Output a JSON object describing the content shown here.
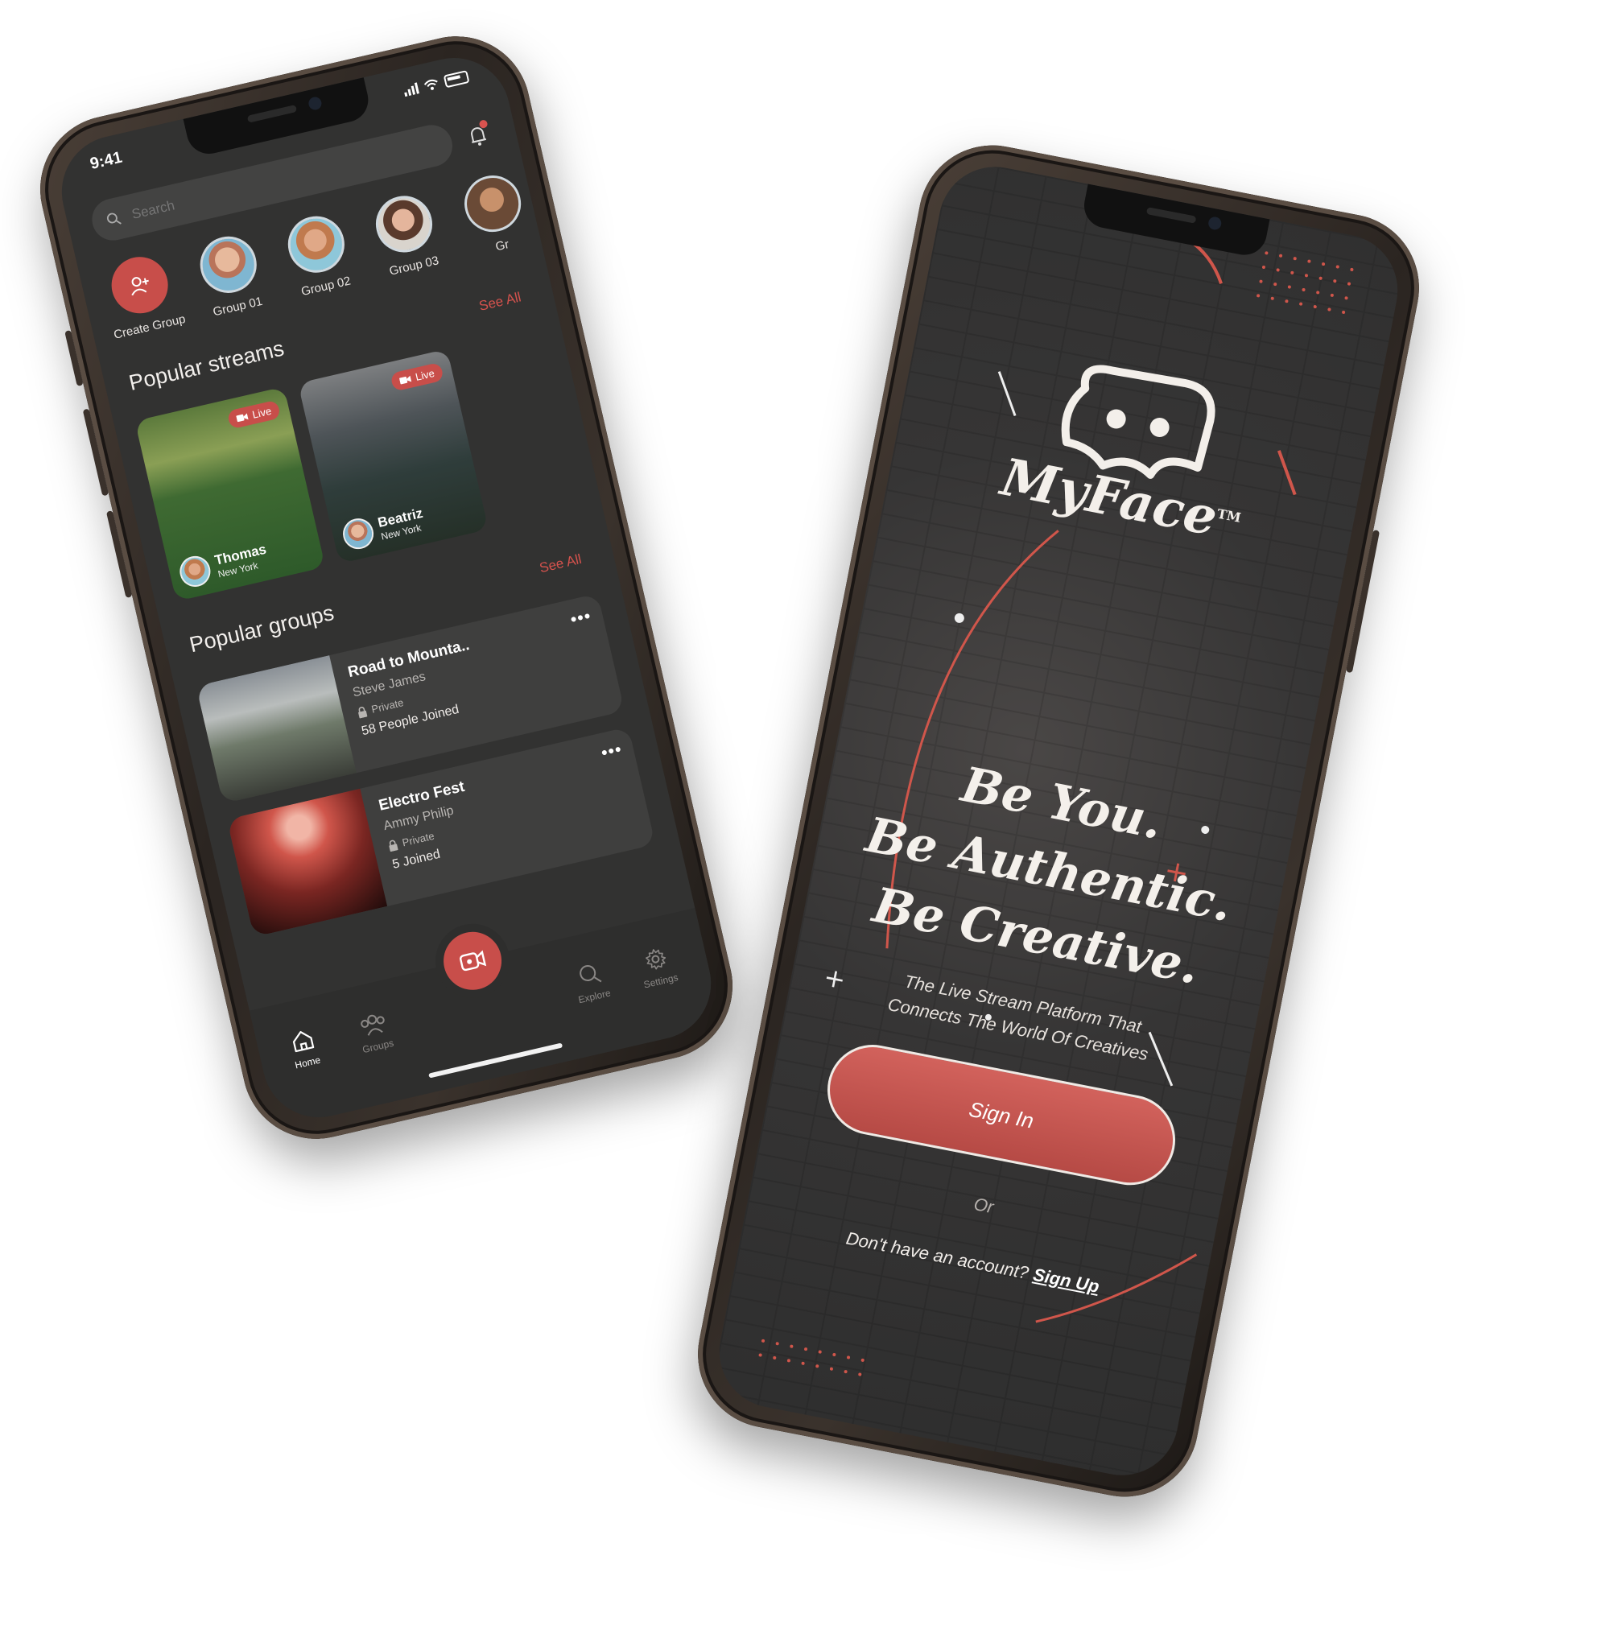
{
  "left_phone": {
    "status": {
      "time": "9:41"
    },
    "search": {
      "placeholder": "Search"
    },
    "groups": [
      {
        "label": "Create Group",
        "type": "create"
      },
      {
        "label": "Group 01"
      },
      {
        "label": "Group 02"
      },
      {
        "label": "Group 03"
      },
      {
        "label": "Gr"
      }
    ],
    "popular_streams": {
      "title": "Popular streams",
      "see_all": "See All",
      "items": [
        {
          "live": "Live",
          "name": "Thomas",
          "location": "New York"
        },
        {
          "live": "Live",
          "name": "Beatriz",
          "location": "New York"
        }
      ]
    },
    "popular_groups": {
      "title": "Popular groups",
      "see_all": "See All",
      "items": [
        {
          "name": "Road to Mounta..",
          "owner": "Steve James",
          "privacy": "Private",
          "joined": "58 People Joined"
        },
        {
          "name": "Electro Fest",
          "owner": "Ammy Philip",
          "privacy": "Private",
          "joined": "5 Joined"
        }
      ]
    },
    "tabs": {
      "home": "Home",
      "groups": "Groups",
      "explore": "Explore",
      "settings": "Settings"
    }
  },
  "right_phone": {
    "brand": "MyFace",
    "trademark": "TM",
    "headline": [
      "Be You.",
      "Be Authentic.",
      "Be Creative."
    ],
    "subtitle": [
      "The Live Stream Platform That",
      "Connects The World Of Creatives"
    ],
    "sign_in": "Sign In",
    "or": "Or",
    "no_account": "Don't have an account?",
    "sign_up": "Sign Up"
  },
  "colors": {
    "accent": "#c84e4a",
    "screen_bg": "#323231",
    "frame": "#2b2521"
  }
}
